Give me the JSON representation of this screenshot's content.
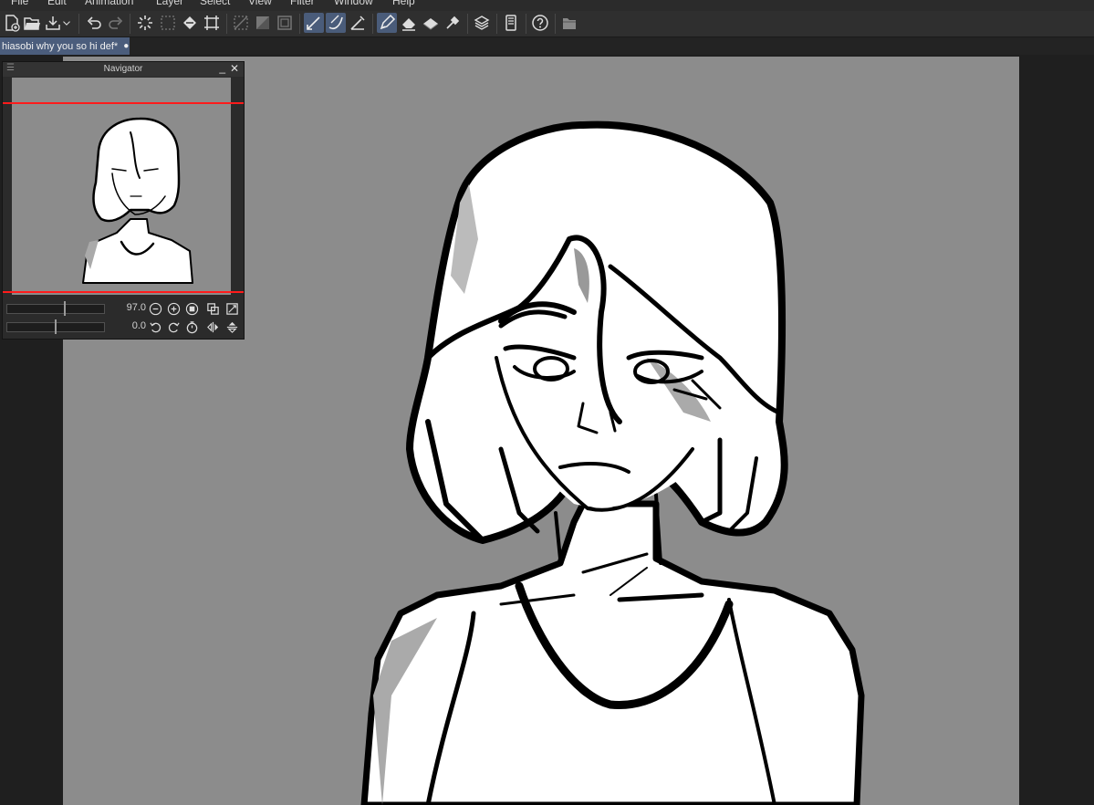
{
  "menu": [
    "File",
    "Edit",
    "Animation",
    "Layer",
    "Select",
    "View",
    "Filter",
    "Window",
    "Help"
  ],
  "toolbar": {
    "icons": [
      "new-file-icon",
      "open-folder-icon",
      "save-icon",
      "undo-icon",
      "redo-icon",
      "loading-icon",
      "fill-icon",
      "transform-icon",
      "deselect-icon",
      "invert-selection-icon",
      "selection-border-icon",
      "pen-snap-icon",
      "curve-snap-icon",
      "ruler-snap-icon",
      "pen-icon",
      "eraser-icon",
      "transparent-color-icon",
      "eyedropper-icon",
      "layer-icon",
      "device-icon",
      "help-icon",
      "folder-icon"
    ],
    "active": [
      "pen-snap-icon",
      "pen-icon"
    ]
  },
  "document_tab": {
    "title": "hiasobi why you so hi def*",
    "modified_marker": "●"
  },
  "navigator": {
    "title": "Navigator",
    "minimize": "_",
    "close": "✕",
    "zoom_value": "97.0",
    "rotation_value": "0.0",
    "zoom_slider_level": 0.6,
    "rotation_slider_level": 0.5,
    "buttons": [
      "zoom-out-icon",
      "zoom-in-icon",
      "fit-icon",
      "actual-size-icon",
      "fill-window-icon",
      "rotate-left-icon",
      "rotate-right-icon",
      "reset-rotation-icon",
      "flip-horizontal-icon",
      "flip-vertical-icon"
    ]
  },
  "colors": {
    "canvas_bg": "#8c8c8c",
    "active_tab": "#4b5d7c",
    "navigator_frame": "#ff1b1b"
  }
}
